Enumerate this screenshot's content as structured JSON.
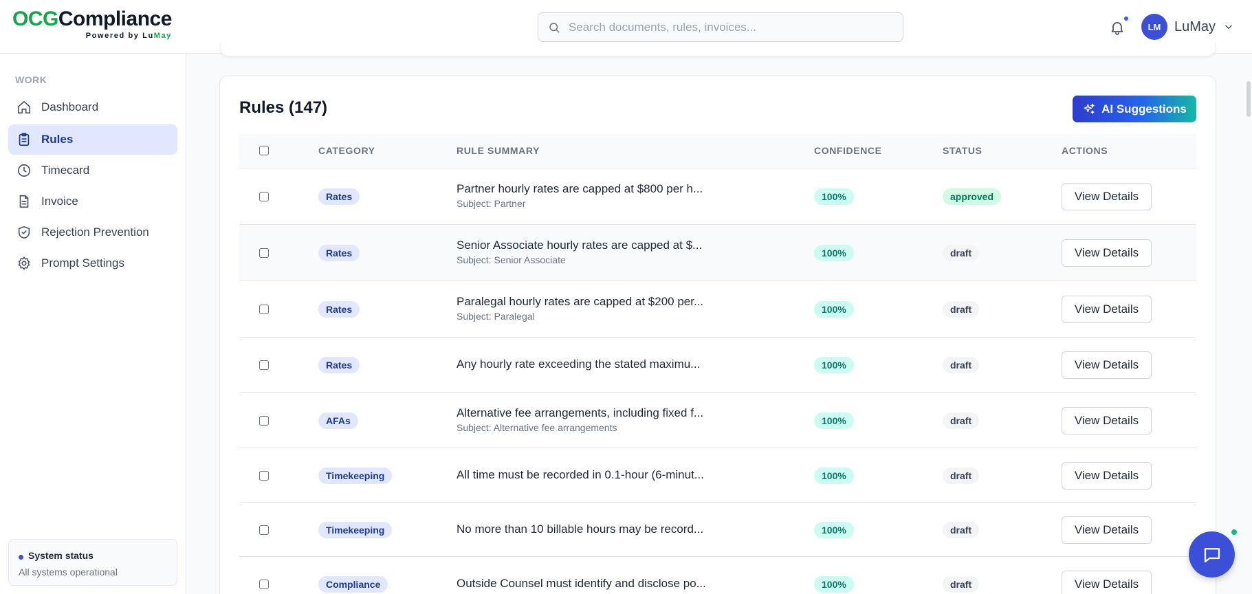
{
  "header": {
    "logo_ocg": "OCG",
    "logo_rest": "Compliance",
    "logo_sub_prefix": "Powered by Lu",
    "logo_sub_brand": "May",
    "search_placeholder": "Search documents, rules, invoices...",
    "avatar_initials": "LM",
    "username": "LuMay"
  },
  "sidebar": {
    "section": "WORK",
    "items": [
      {
        "label": "Dashboard",
        "icon": "home-icon"
      },
      {
        "label": "Rules",
        "icon": "clipboard-icon",
        "active": true
      },
      {
        "label": "Timecard",
        "icon": "clock-icon"
      },
      {
        "label": "Invoice",
        "icon": "document-icon"
      },
      {
        "label": "Rejection Prevention",
        "icon": "shield-icon"
      },
      {
        "label": "Prompt Settings",
        "icon": "gear-icon"
      }
    ],
    "status_title": "System status",
    "status_text": "All systems operational"
  },
  "rules": {
    "title": "Rules (147)",
    "ai_button": "AI Suggestions",
    "columns": {
      "category": "CATEGORY",
      "summary": "RULE SUMMARY",
      "confidence": "CONFIDENCE",
      "status": "STATUS",
      "actions": "ACTIONS"
    },
    "rows": [
      {
        "category": "Rates",
        "summary": "Partner hourly rates are capped at $800 per h...",
        "subject": "Subject: Partner",
        "confidence": "100%",
        "status": "approved",
        "action": "View Details"
      },
      {
        "category": "Rates",
        "summary": "Senior Associate hourly rates are capped at $...",
        "subject": "Subject: Senior Associate",
        "confidence": "100%",
        "status": "draft",
        "action": "View Details"
      },
      {
        "category": "Rates",
        "summary": "Paralegal hourly rates are capped at $200 per...",
        "subject": "Subject: Paralegal",
        "confidence": "100%",
        "status": "draft",
        "action": "View Details"
      },
      {
        "category": "Rates",
        "summary": "Any hourly rate exceeding the stated maximu...",
        "subject": "",
        "confidence": "100%",
        "status": "draft",
        "action": "View Details"
      },
      {
        "category": "AFAs",
        "summary": "Alternative fee arrangements, including fixed f...",
        "subject": "Subject: Alternative fee arrangements",
        "confidence": "100%",
        "status": "draft",
        "action": "View Details"
      },
      {
        "category": "Timekeeping",
        "summary": "All time must be recorded in 0.1-hour (6-minut...",
        "subject": "",
        "confidence": "100%",
        "status": "draft",
        "action": "View Details"
      },
      {
        "category": "Timekeeping",
        "summary": "No more than 10 billable hours may be record...",
        "subject": "",
        "confidence": "100%",
        "status": "draft",
        "action": "View Details"
      },
      {
        "category": "Compliance",
        "summary": "Outside Counsel must identify and disclose po...",
        "subject": "",
        "confidence": "100%",
        "status": "draft",
        "action": "View Details"
      }
    ]
  }
}
